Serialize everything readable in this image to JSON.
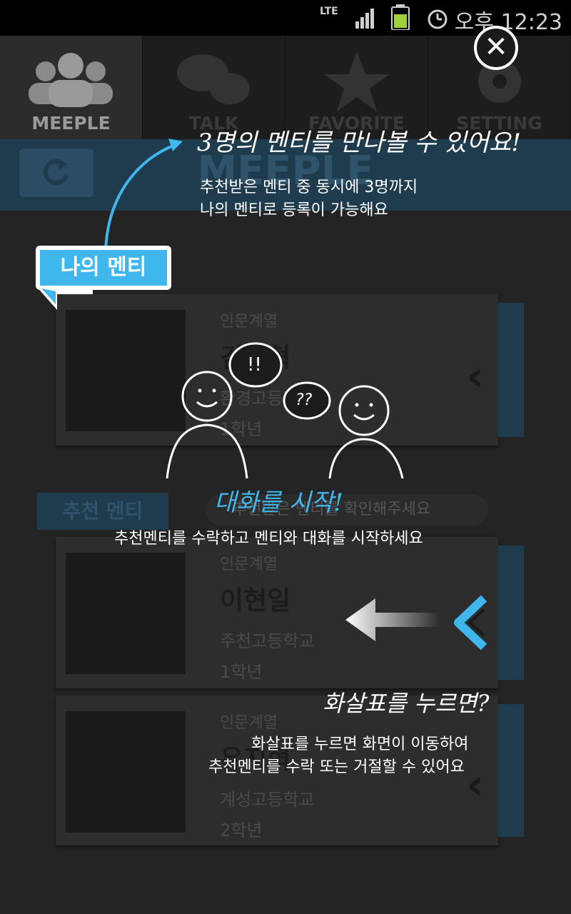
{
  "status_bar": {
    "network": "LTE",
    "time": "오후 12:23"
  },
  "tabs": [
    {
      "label": "MEEPLE",
      "icon": "people-icon",
      "active": true
    },
    {
      "label": "TALK",
      "icon": "chat-icon",
      "active": false
    },
    {
      "label": "FAVORITE",
      "icon": "star-icon",
      "active": false
    },
    {
      "label": "SETTING",
      "icon": "gear-icon",
      "active": false
    }
  ],
  "header": {
    "title": "MEEPLE"
  },
  "my_mentor": {
    "field": "인문계열",
    "name": "김승혁",
    "school": "환경고등학교",
    "grade": "1학년"
  },
  "recommended": {
    "label": "추천 멘티",
    "notice": "추천받은 멘티를 확인해주세요",
    "items": [
      {
        "field": "인문계열",
        "name": "이현일",
        "school": "주천고등학교",
        "grade": "1학년"
      },
      {
        "field": "인문계열",
        "name": "유지혁",
        "school": "계성고등학교",
        "grade": "2학년"
      }
    ]
  },
  "overlay": {
    "bubble_label": "나의 멘티",
    "tip1_title": "3명의 멘티를 만나볼 수 있어요!",
    "tip1_line1": "추천받은 멘티 중 동시에 3명까지",
    "tip1_line2": "나의 멘티로 등록이 가능해요",
    "exclaim1": "!!",
    "exclaim2": "??",
    "tip2_title": "대화를 시작!",
    "tip2_line": "추천멘티를 수락하고 멘티와 대화를 시작하세요",
    "tip3_title": "화살표를 누르면?",
    "tip3_line1": "화살표를 누르면 화면이 이동하여",
    "tip3_line2": "추천멘티를 수락 또는 거절할 수 있어요"
  },
  "colors": {
    "accent": "#3fb6ec",
    "header": "#1f3c4e"
  }
}
